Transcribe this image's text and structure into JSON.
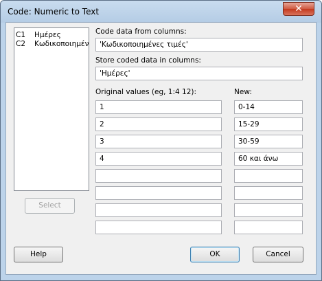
{
  "window": {
    "title": "Code: Numeric to Text",
    "close_symbol": "✕"
  },
  "variables": [
    {
      "id": "C1",
      "name": "Ημέρες"
    },
    {
      "id": "C2",
      "name": "Κωδικοποιημένες τιμές"
    }
  ],
  "code_from": {
    "label": "Code data from columns:",
    "value": "'Κωδικοποιημένες τιμές'"
  },
  "store_in": {
    "label": "Store coded data in columns:",
    "value": "'Ημέρες'"
  },
  "original": {
    "label": "Original values (eg,  1:4  12):",
    "values": [
      "1",
      "2",
      "3",
      "4",
      "",
      "",
      "",
      ""
    ]
  },
  "new": {
    "label": "New:",
    "values": [
      "0-14",
      "15-29",
      "30-59",
      "60 και άνω",
      "",
      "",
      "",
      ""
    ]
  },
  "buttons": {
    "select": "Select",
    "help": "Help",
    "ok": "OK",
    "cancel": "Cancel"
  }
}
